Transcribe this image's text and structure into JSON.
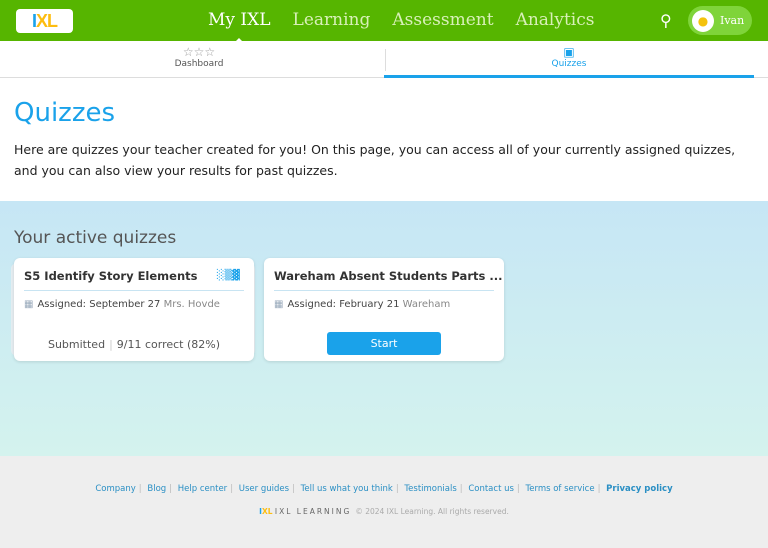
{
  "header": {
    "logo": "IXL",
    "nav": [
      "My IXL",
      "Learning",
      "Assessment",
      "Analytics"
    ],
    "user": "Ivan"
  },
  "subnav": {
    "tabs": [
      "Dashboard",
      "Quizzes"
    ]
  },
  "page": {
    "title": "Quizzes",
    "intro": "Here are quizzes your teacher created for you! On this page, you can access all of your currently assigned quizzes, and you can also view your results for past quizzes."
  },
  "active": {
    "heading": "Your active quizzes",
    "quizzes": [
      {
        "title": "S5 Identify Story Elements",
        "assigned": "Assigned: September 27",
        "teacher": "Mrs. Hovde",
        "status": "Submitted",
        "score": "9/11 correct (82%)"
      },
      {
        "title": "Wareham Absent Students Parts ...",
        "assigned": "Assigned: February 21",
        "teacher": "Wareham",
        "action": "Start"
      }
    ]
  },
  "footer": {
    "links": [
      "Company",
      "Blog",
      "Help center",
      "User guides",
      "Tell us what you think",
      "Testimonials",
      "Contact us",
      "Terms of service",
      "Privacy policy"
    ],
    "logo": "IXL LEARNING",
    "copyright": "© 2024 IXL Learning. All rights reserved."
  }
}
